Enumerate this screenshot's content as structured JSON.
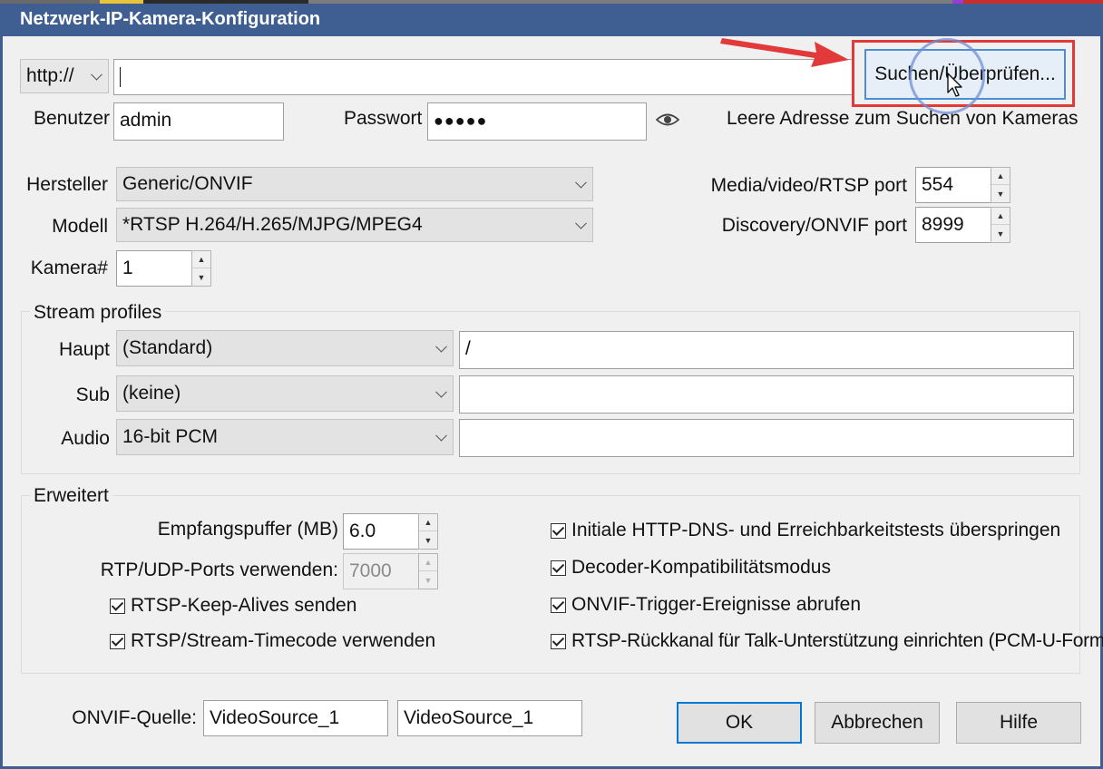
{
  "window": {
    "title": "Netzwerk-IP-Kamera-Konfiguration"
  },
  "address": {
    "protocol": "http://",
    "url_value": "",
    "search_button": "Suchen/Überprüfen..."
  },
  "credentials": {
    "user_label": "Benutzer",
    "user_value": "admin",
    "password_label": "Passwort",
    "password_value": "●●●●●",
    "hint": "Leere Adresse zum Suchen von Kameras"
  },
  "device": {
    "manufacturer_label": "Hersteller",
    "manufacturer_value": "Generic/ONVIF",
    "model_label": "Modell",
    "model_value": "*RTSP H.264/H.265/MJPG/MPEG4",
    "camera_label": "Kamera#",
    "camera_value": "1",
    "media_port_label": "Media/video/RTSP port",
    "media_port_value": "554",
    "discovery_port_label": "Discovery/ONVIF port",
    "discovery_port_value": "8999"
  },
  "stream_profiles": {
    "title": "Stream profiles",
    "main_label": "Haupt",
    "main_value": "(Standard)",
    "main_path": "/",
    "sub_label": "Sub",
    "sub_value": "(keine)",
    "sub_path": "",
    "audio_label": "Audio",
    "audio_value": "16-bit PCM",
    "audio_path": ""
  },
  "advanced": {
    "title": "Erweitert",
    "buffer_label": "Empfangspuffer (MB)",
    "buffer_value": "6.0",
    "rtp_label": "RTP/UDP-Ports verwenden:",
    "rtp_value": "7000",
    "options": [
      {
        "label": "RTSP-Keep-Alives senden",
        "checked": true
      },
      {
        "label": "RTSP/Stream-Timecode verwenden",
        "checked": true
      },
      {
        "label": "Initiale HTTP-DNS- und Erreichbarkeitstests überspringen",
        "checked": true
      },
      {
        "label": "Decoder-Kompatibilitätsmodus",
        "checked": true
      },
      {
        "label": "ONVIF-Trigger-Ereignisse abrufen",
        "checked": true
      },
      {
        "label": "RTSP-Rückkanal für Talk-Unterstützung einrichten (PCM-U-Format)",
        "checked": true
      }
    ]
  },
  "footer": {
    "onvif_label": "ONVIF-Quelle:",
    "onvif_value_1": "VideoSource_1",
    "onvif_value_2": "VideoSource_1",
    "ok": "OK",
    "cancel": "Abbrechen",
    "help": "Hilfe"
  },
  "colors": {
    "title_bar": "#3f5f92",
    "annotation_red": "#e23a3a",
    "focus_blue": "#0078d7"
  },
  "icons": {
    "eye": "eye-icon",
    "dropdown": "chevron-down-icon",
    "spin_up": "arrow-up-icon",
    "spin_down": "arrow-down-icon",
    "cursor": "mouse-cursor-icon",
    "annotation": "red-arrow-icon"
  }
}
